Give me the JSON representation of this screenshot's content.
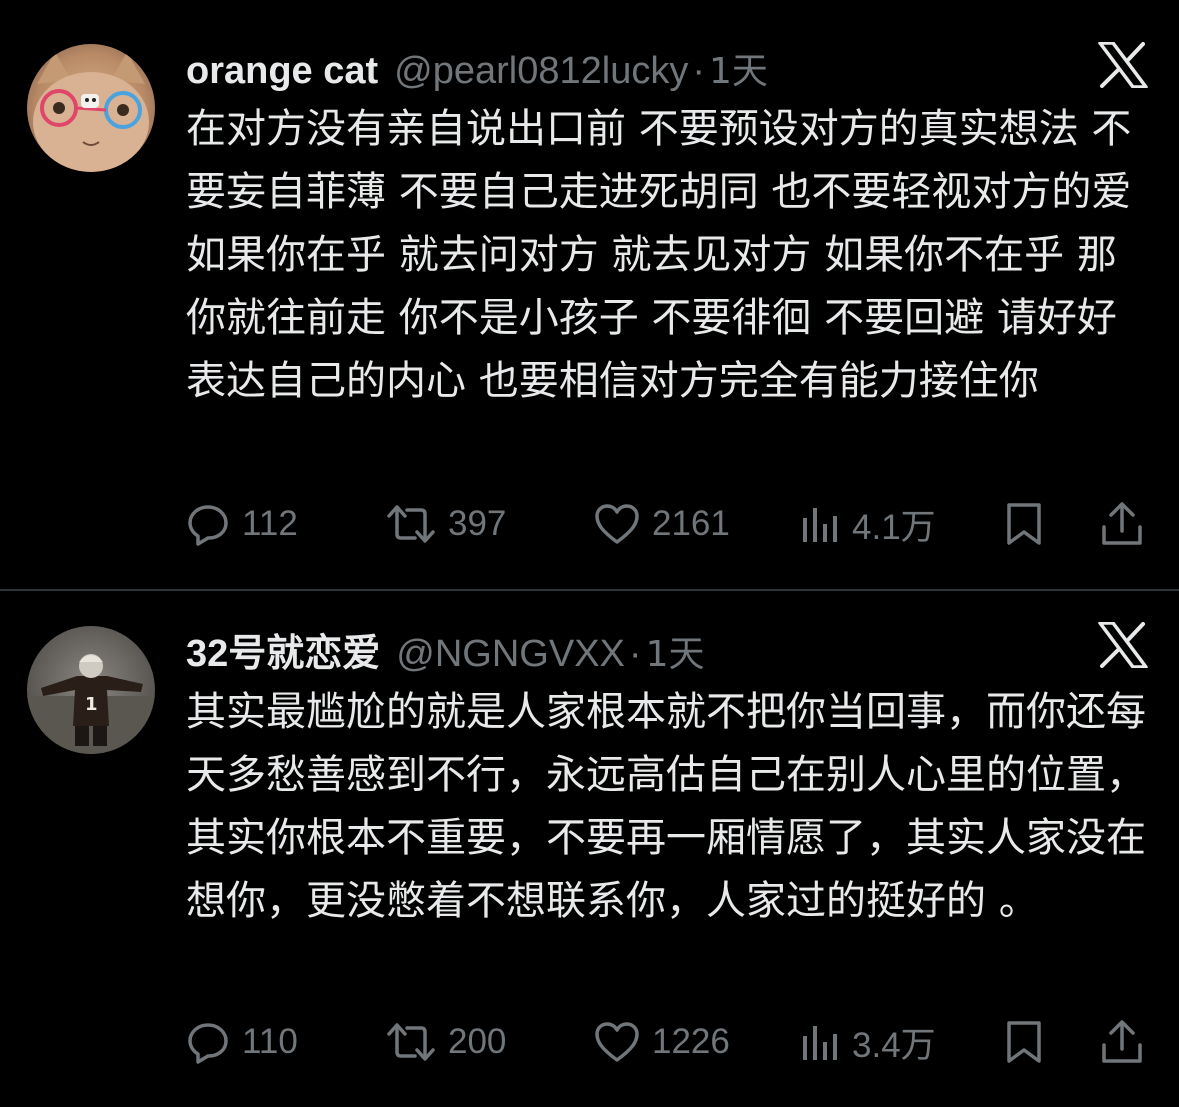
{
  "tweets": [
    {
      "display_name": "orange cat",
      "handle": "@pearl0812lucky",
      "separator": "·",
      "time": "1天",
      "text": "在对方没有亲自说出口前 不要预设对方的真实想法 不要妄自菲薄 不要自己走进死胡同 也不要轻视对方的爱 如果你在乎 就去问对方 就去见对方 如果你不在乎 那你就往前走 你不是小孩子 不要徘徊 不要回避 请好好表达自己的内心 也要相信对方完全有能力接住你",
      "replies": "112",
      "retweets": "397",
      "likes": "2161",
      "views": "4.1万",
      "avatar_icon": "cat-with-glasses-avatar"
    },
    {
      "display_name": "32号就恋爱",
      "handle": "@NGNGVXX",
      "separator": "·",
      "time": "1天",
      "text": "其实最尴尬的就是人家根本就不把你当回事，而你还每天多愁善感到不行，永远高估自己在别人心里的位置，其实你根本不重要，不要再一厢情愿了，其实人家没在想你，更没憋着不想联系你，人家过的挺好的 。",
      "replies": "110",
      "retweets": "200",
      "likes": "1226",
      "views": "3.4万",
      "avatar_icon": "person-number-1-avatar"
    }
  ],
  "icons": {
    "platform": "x-logo-icon",
    "reply": "reply-icon",
    "retweet": "retweet-icon",
    "like": "heart-icon",
    "views": "views-bar-chart-icon",
    "bookmark": "bookmark-icon",
    "share": "share-icon"
  },
  "colors": {
    "background": "#000000",
    "primary_text": "#e7e9ea",
    "secondary_text": "#71767b",
    "divider": "#2f3336"
  }
}
